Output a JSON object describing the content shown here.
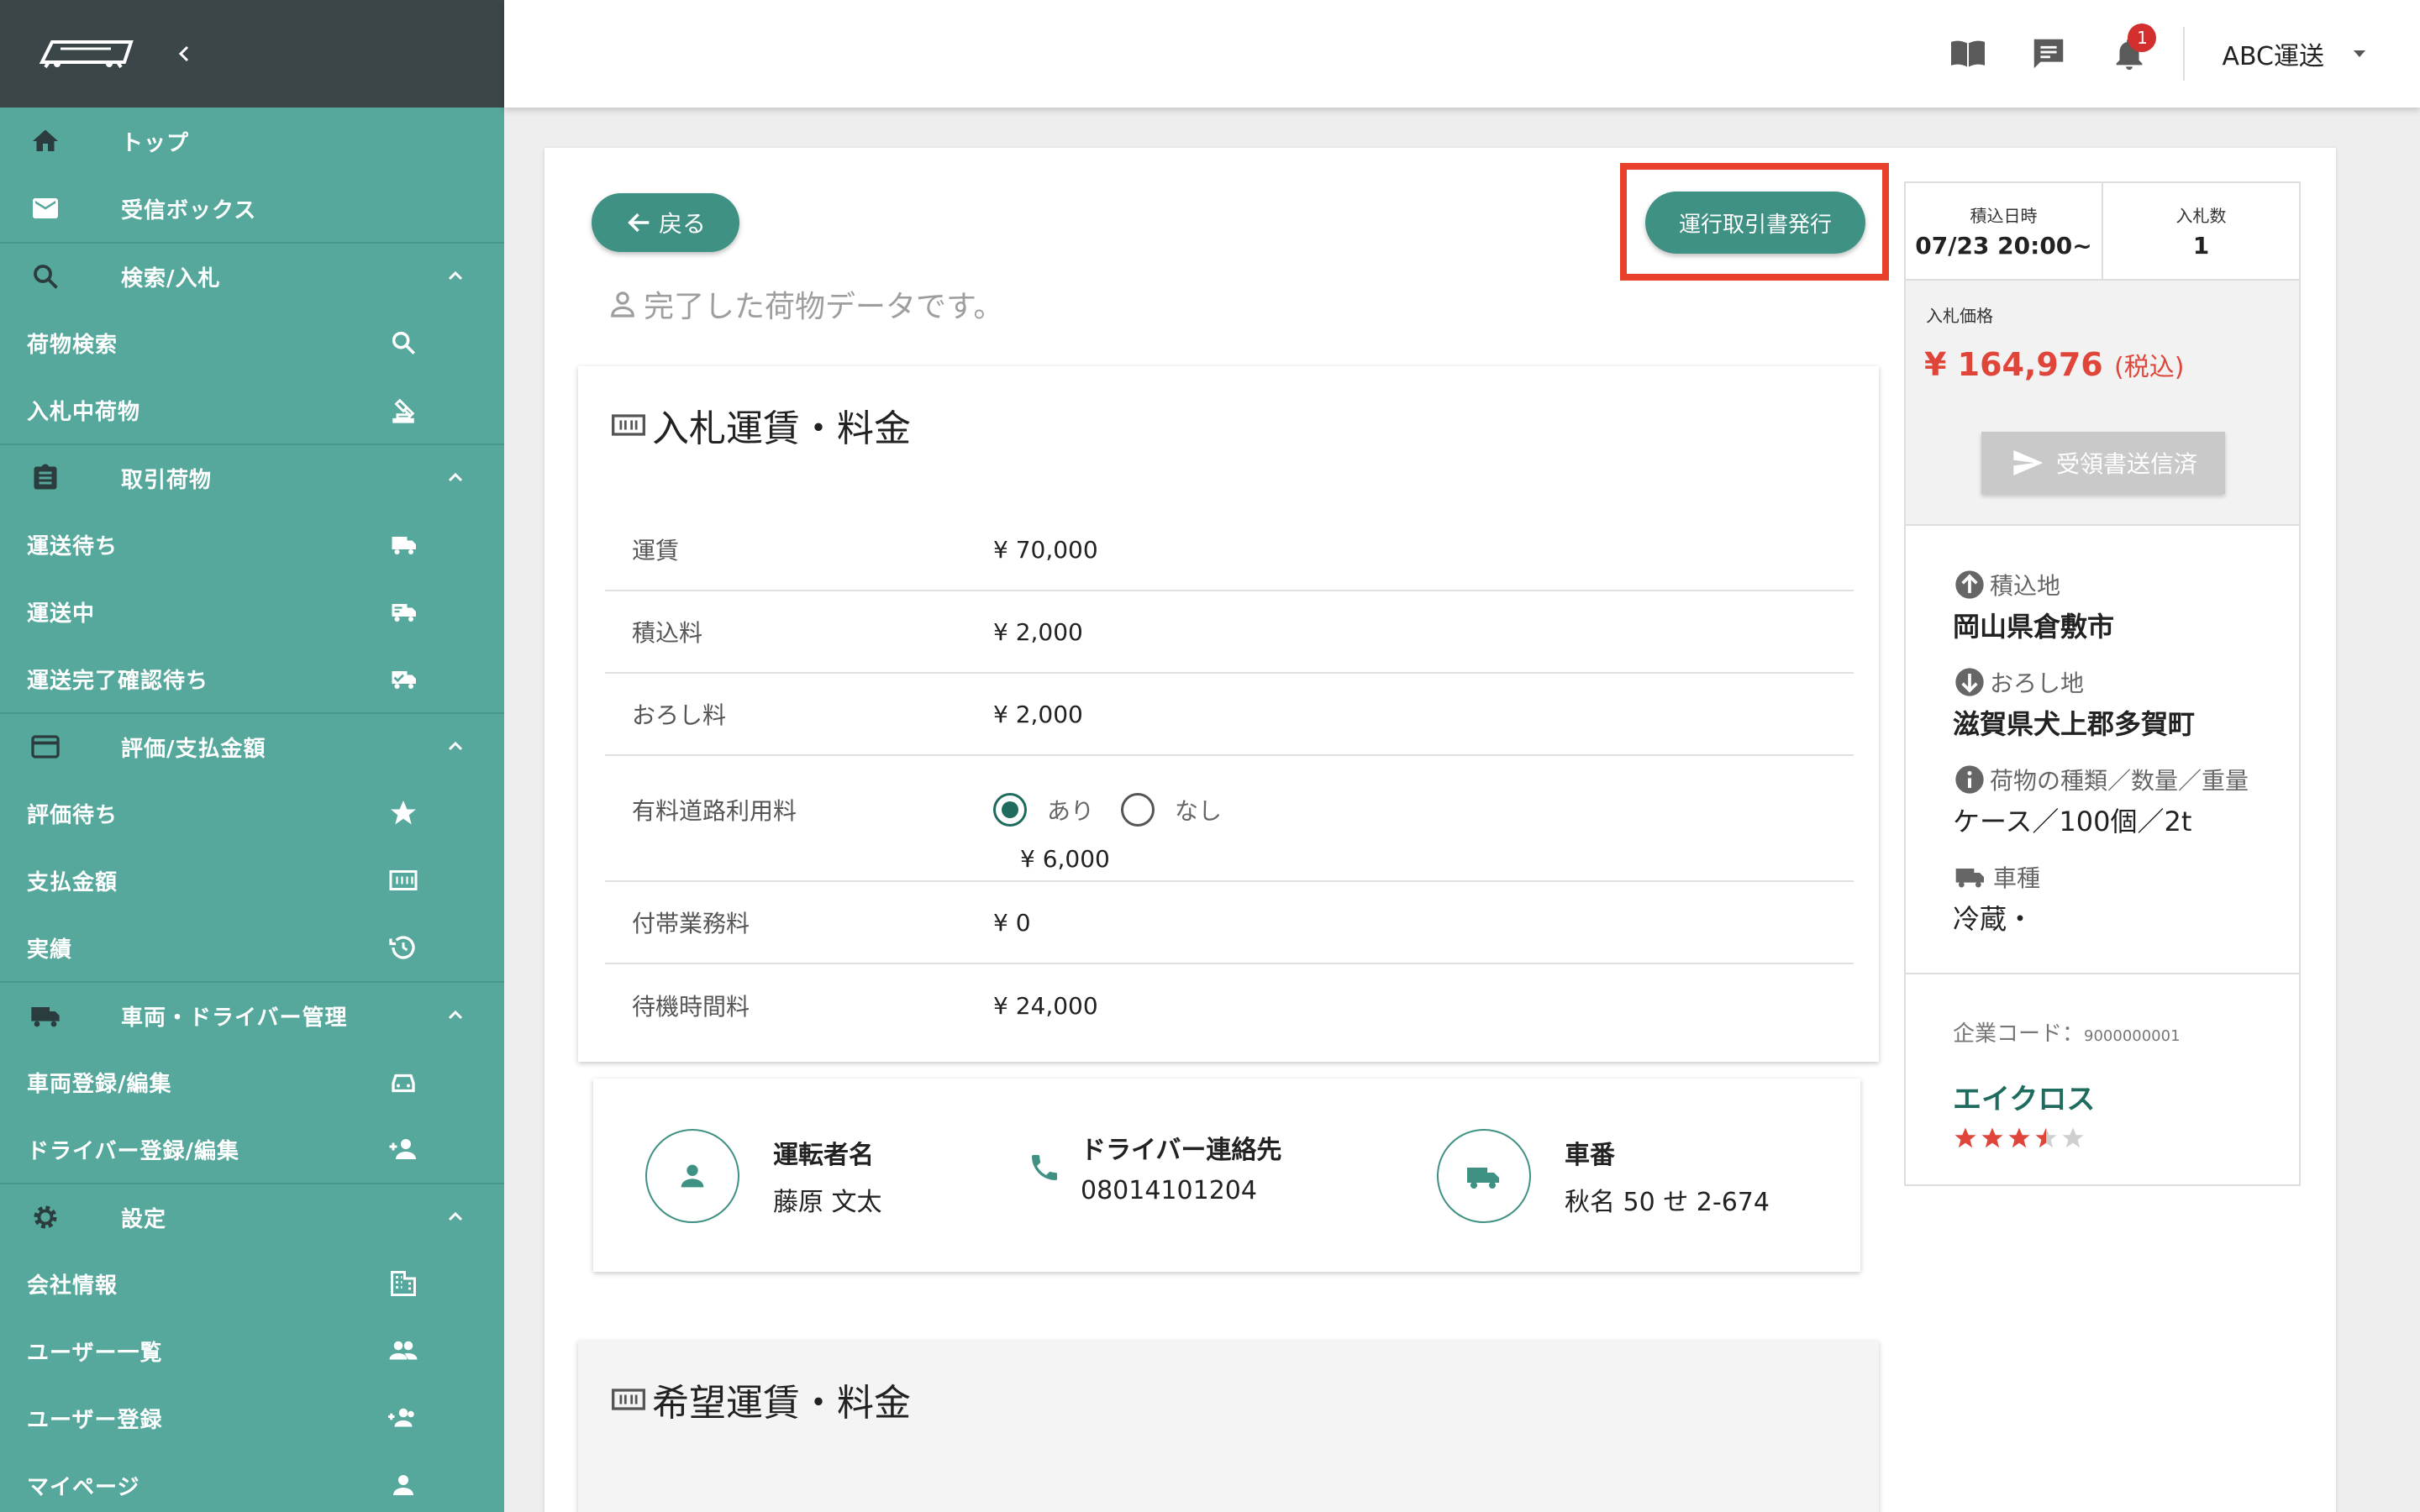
{
  "sidebar": {
    "items": [
      {
        "label": "トップ",
        "icon": "home-icon"
      },
      {
        "label": "受信ボックス",
        "icon": "mail-icon"
      },
      {
        "label": "検索/入札",
        "icon": "search-icon"
      },
      {
        "label": "荷物検索",
        "icon": "search-icon"
      },
      {
        "label": "入札中荷物",
        "icon": "gavel-icon"
      },
      {
        "label": "取引荷物",
        "icon": "clipboard-icon"
      },
      {
        "label": "運送待ち",
        "icon": "truck-icon"
      },
      {
        "label": "運送中",
        "icon": "truck-moving-icon"
      },
      {
        "label": "運送完了確認待ち",
        "icon": "truck-check-icon"
      },
      {
        "label": "評価/支払金額",
        "icon": "credit-card-icon"
      },
      {
        "label": "評価待ち",
        "icon": "star-icon"
      },
      {
        "label": "支払金額",
        "icon": "money-icon"
      },
      {
        "label": "実績",
        "icon": "history-icon"
      },
      {
        "label": "車両・ドライバー管理",
        "icon": "truck-icon"
      },
      {
        "label": "車両登録/編集",
        "icon": "car-icon"
      },
      {
        "label": "ドライバー登録/編集",
        "icon": "person-add-icon"
      },
      {
        "label": "設定",
        "icon": "gear-icon"
      },
      {
        "label": "会社情報",
        "icon": "building-icon"
      },
      {
        "label": "ユーザー一覧",
        "icon": "people-icon"
      },
      {
        "label": "ユーザー登録",
        "icon": "group-add-icon"
      },
      {
        "label": "マイページ",
        "icon": "person-icon"
      }
    ]
  },
  "header": {
    "notification_count": "1",
    "company": "ABC運送"
  },
  "main": {
    "back_label": "戻る",
    "issue_button_label": "運行取引書発行",
    "done_message": "完了した荷物データです。",
    "fare_panel": {
      "title": "入札運賃・料金",
      "rows": [
        {
          "label": "運賃",
          "value": "¥ 70,000"
        },
        {
          "label": "積込料",
          "value": "¥ 2,000"
        },
        {
          "label": "おろし料",
          "value": "¥ 2,000"
        },
        {
          "label": "有料道路利用料",
          "value": "¥ 6,000"
        },
        {
          "label": "付帯業務料",
          "value": "¥ 0"
        },
        {
          "label": "待機時間料",
          "value": "¥ 24,000"
        }
      ],
      "toll_options": {
        "yes": "あり",
        "no": "なし",
        "selected": "あり"
      }
    },
    "driver": {
      "name_label": "運転者名",
      "name": "藤原 文太",
      "contact_label": "ドライバー連絡先",
      "contact": "08014101204",
      "plate_label": "車番",
      "plate": "秋名 50 せ 2-674"
    },
    "hope_panel": {
      "title": "希望運賃・料金"
    }
  },
  "info": {
    "loading_datetime_label": "積込日時",
    "loading_datetime": "07/23 20:00~",
    "bid_count_label": "入札数",
    "bid_count": "1",
    "bid_price_label": "入札価格",
    "bid_price": "¥ 164,976",
    "tax_note": "(税込)",
    "receipt_button_label": "受領書送信済",
    "pickup_label": "積込地",
    "pickup": "岡山県倉敷市",
    "dropoff_label": "おろし地",
    "dropoff": "滋賀県犬上郡多賀町",
    "cargo_label": "荷物の種類／数量／重量",
    "cargo": "ケース／100個／2t",
    "vehicle_label": "車種",
    "vehicle": "冷蔵・",
    "company_code_label": "企業コード：",
    "company_code": "9000000001",
    "company_name": "エイクロス",
    "rating": 3.5,
    "rating_max": 5
  },
  "colors": {
    "sidebar": "#55a89b",
    "sidebar_top": "#3a4648",
    "accent": "#3f9184",
    "price": "#e0453a",
    "highlight": "#e8402a",
    "star": "#e0453a"
  }
}
